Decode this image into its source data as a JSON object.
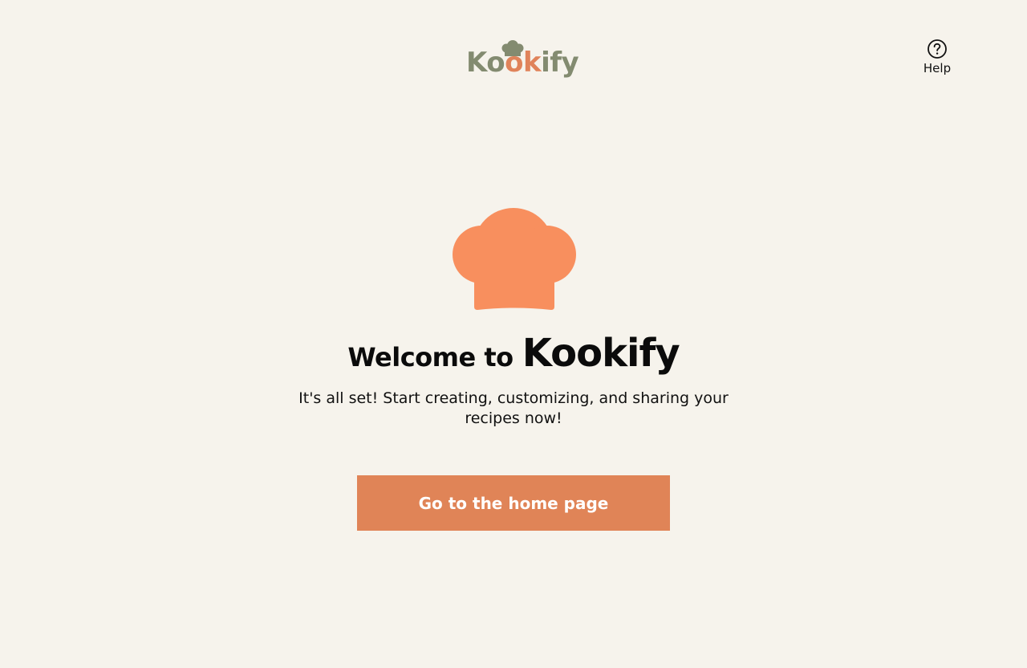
{
  "header": {
    "logo": {
      "text_segments": [
        "Ko",
        "ok",
        "ify"
      ],
      "colors": {
        "green": "#838b70",
        "orange": "#e0835a"
      },
      "icon": "chef-hat-icon"
    },
    "help": {
      "icon": "question-circle-icon",
      "label": "Help"
    }
  },
  "hero": {
    "icon": "chef-hat-icon",
    "icon_color": "#f88f5e",
    "title_prefix": "Welcome to",
    "title_brand": "Kookify",
    "subtitle": "It's all set! Start creating, customizing, and sharing your recipes now!"
  },
  "cta": {
    "label": "Go to the home page",
    "background": "#e08457",
    "text_color": "#ffffff"
  },
  "page": {
    "background": "#f6f3ec"
  }
}
